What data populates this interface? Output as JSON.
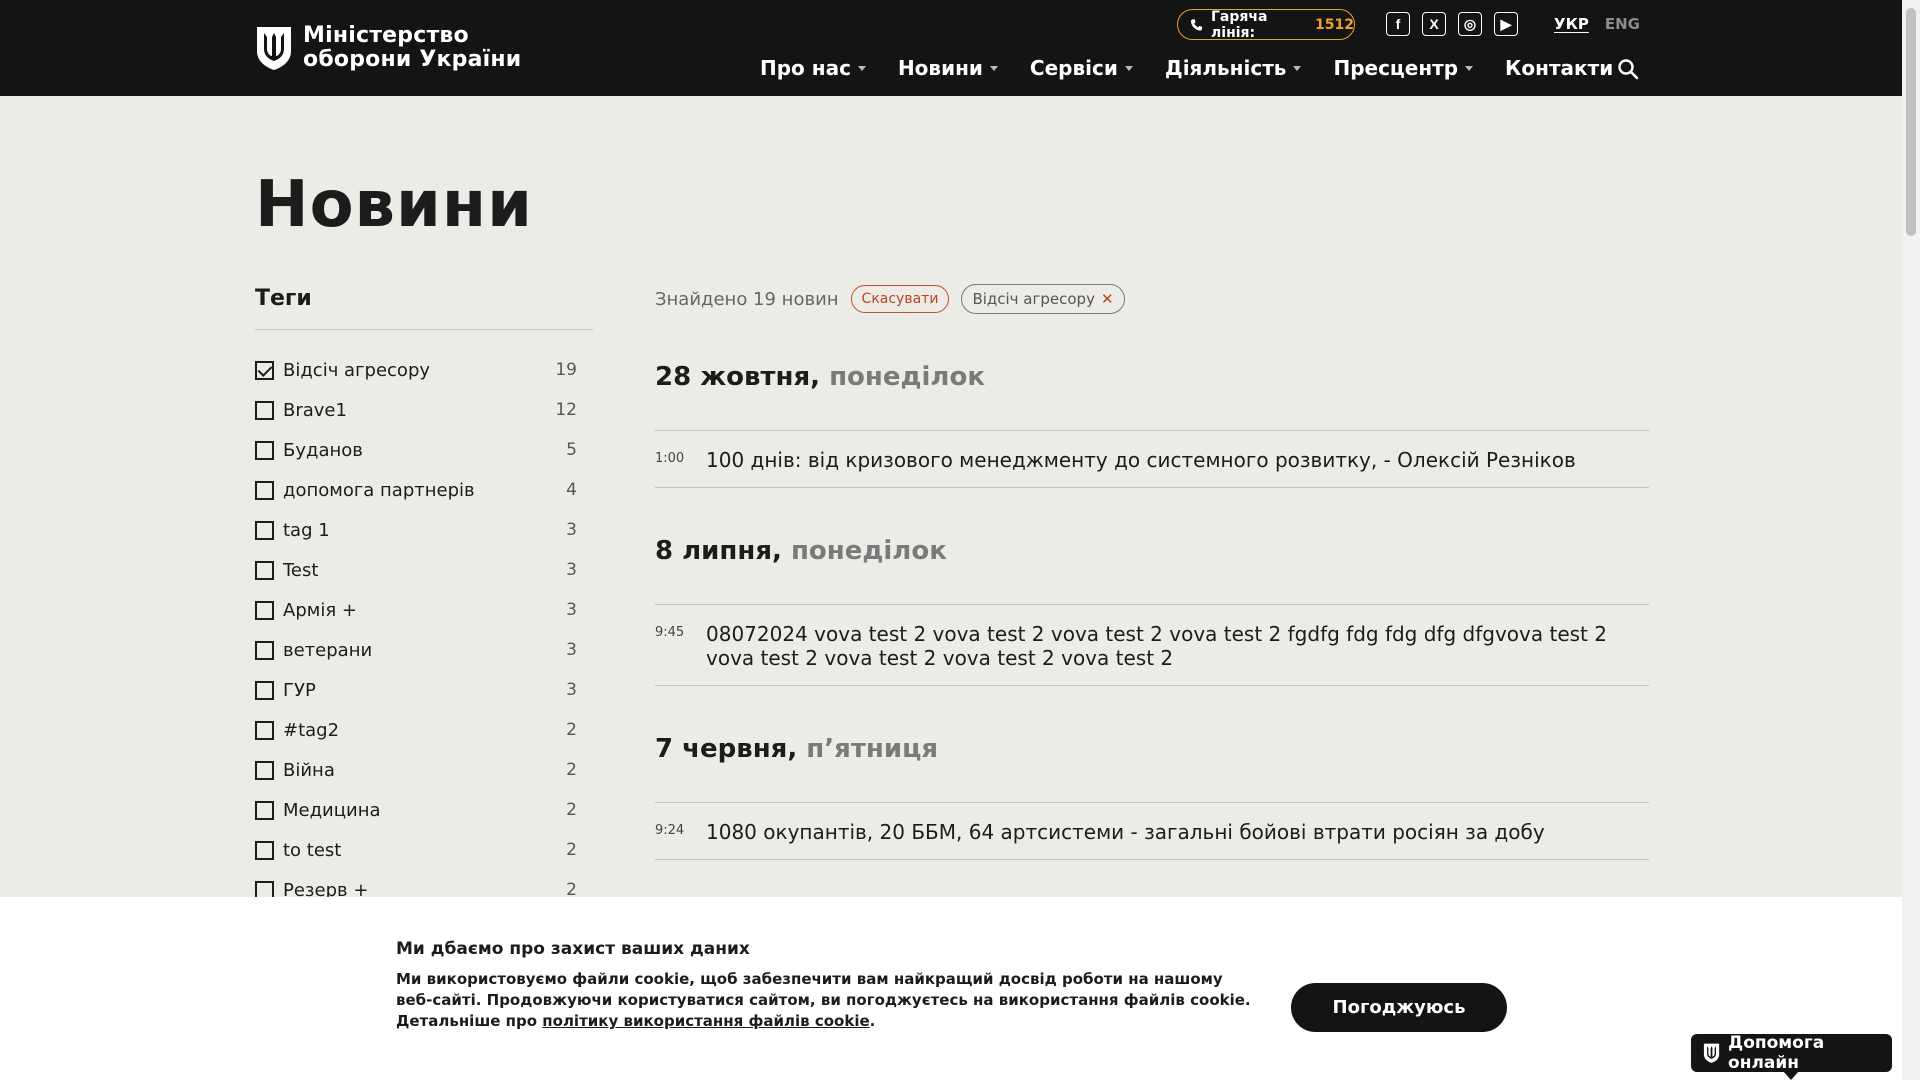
{
  "header": {
    "logo_line1": "Міністерство",
    "logo_line2": "оборони України",
    "hotline_label": "Гаряча лінія:",
    "hotline_number": "1512",
    "socials": [
      "f",
      "X",
      "◎",
      "▶"
    ],
    "lang_active": "УКР",
    "lang_other": "ENG",
    "nav": [
      {
        "label": "Про нас",
        "has_caret": true
      },
      {
        "label": "Новини",
        "has_caret": true
      },
      {
        "label": "Сервіси",
        "has_caret": true
      },
      {
        "label": "Діяльність",
        "has_caret": true
      },
      {
        "label": "Пресцентр",
        "has_caret": true
      },
      {
        "label": "Контакти",
        "has_caret": false
      }
    ]
  },
  "page_title": "Новини",
  "sidebar": {
    "title": "Теги",
    "tags": [
      {
        "label": "Відсіч агресору",
        "count": "19",
        "checked": true
      },
      {
        "label": "Brave1",
        "count": "12",
        "checked": false
      },
      {
        "label": "Буданов",
        "count": "5",
        "checked": false
      },
      {
        "label": "допомога партнерів",
        "count": "4",
        "checked": false
      },
      {
        "label": "tag 1",
        "count": "3",
        "checked": false
      },
      {
        "label": "Test",
        "count": "3",
        "checked": false
      },
      {
        "label": "Армія +",
        "count": "3",
        "checked": false
      },
      {
        "label": "ветерани",
        "count": "3",
        "checked": false
      },
      {
        "label": "ГУР",
        "count": "3",
        "checked": false
      },
      {
        "label": "#tag2",
        "count": "2",
        "checked": false
      },
      {
        "label": "Війна",
        "count": "2",
        "checked": false
      },
      {
        "label": "Медицина",
        "count": "2",
        "checked": false
      },
      {
        "label": "to test",
        "count": "2",
        "checked": false
      },
      {
        "label": "Резерв +",
        "count": "2",
        "checked": false
      }
    ]
  },
  "results": {
    "found": "Знайдено 19 новин",
    "cancel": "Скасувати",
    "active_filter": "Відсіч агресору",
    "groups": [
      {
        "date": "28 жовтня,",
        "weekday": "понеділок",
        "items": [
          {
            "time": "1:00",
            "title": "100 днів: від кризового менеджменту до системного розвитку, - Олексій Резніков"
          }
        ]
      },
      {
        "date": "8 липня,",
        "weekday": "понеділок",
        "items": [
          {
            "time": "9:45",
            "title": "08072024 vova test 2 vova test 2 vova test 2 vova test 2 fgdfg fdg fdg dfg dfgvova test 2 vova test 2 vova test 2 vova test 2 vova test 2"
          }
        ]
      },
      {
        "date": "7 червня,",
        "weekday": "п’ятниця",
        "items": [
          {
            "time": "9:24",
            "title": "1080 окупантів, 20 ББМ, 64 артсистеми - загальні бойові втрати росіян за добу"
          }
        ]
      }
    ]
  },
  "cookie": {
    "title": "Ми дбаємо про захист ваших даних",
    "text": "Ми використовуємо файли cookie, щоб забезпечити вам найкращий досвід роботи на нашому веб-сайті. Продовжуючи користуватися сайтом, ви погоджуєтесь на використання файлів cookie. Детальніше про ",
    "link": "політику використання файлів cookie",
    "text_end": ".",
    "agree": "Погоджуюсь"
  },
  "help_online": "Допомога онлайн"
}
